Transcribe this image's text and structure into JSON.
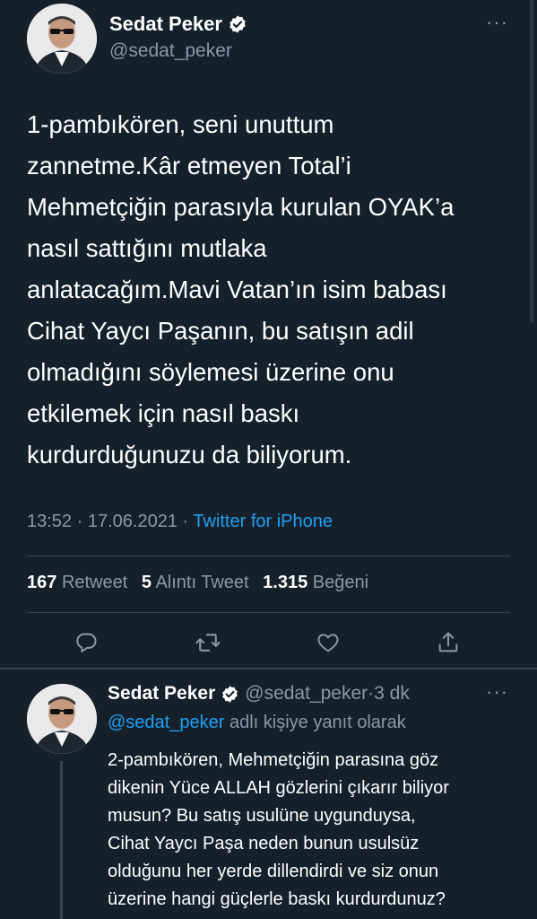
{
  "tweet": {
    "author_name": "Sedat Peker",
    "author_handle": "@sedat_peker",
    "paragraph_lines": [
      "1-pambıkören, seni unuttum",
      "zannetme.Kâr etmeyen Total’i",
      "Mehmetçiğin parasıyla kurulan OYAK’a",
      "nasıl sattığını mutlaka",
      "anlatacağım.Mavi Vatan’ın isim babası",
      "Cihat Yaycı Paşanın, bu satışın adil",
      "olmadığını söylemesi üzerine onu",
      "etkilemek için nasıl baskı",
      "kurdurduğunuzu da biliyorum."
    ],
    "time": "13:52",
    "date": "17.06.2021",
    "source": "Twitter for iPhone",
    "retweets_count": "167",
    "retweets_label": "Retweet",
    "quotes_count": "5",
    "quotes_label": "Alıntı Tweet",
    "likes_count": "1.315",
    "likes_label": "Beğeni",
    "more_label": "···"
  },
  "actions": {
    "reply_icon": "reply-icon",
    "retweet_icon": "retweet-icon",
    "like_icon": "heart-icon",
    "share_icon": "share-icon"
  },
  "reply": {
    "author_name": "Sedat Peker",
    "author_handle": "@sedat_peker",
    "time_ago": "3 dk",
    "replying_mention": "@sedat_peker",
    "replying_text": "adlı kişiye yanıt olarak",
    "lines": [
      "2-pambıkören, Mehmetçiğin parasına göz",
      "dikenin Yüce ALLAH gözlerini çıkarır biliyor",
      "musun? Bu satış usulüne uygunduysa,",
      "Cihat Yaycı Paşa neden bunun usulsüz",
      "olduğunu her yerde dillendirdi ve siz onun",
      "üzerine hangi güçlerle baskı kurdurdunuz?"
    ],
    "more_label": "···"
  },
  "colors": {
    "background": "#15202b",
    "accent": "#1da1f2",
    "secondary_text": "#8899a6",
    "divider": "#38444d"
  }
}
